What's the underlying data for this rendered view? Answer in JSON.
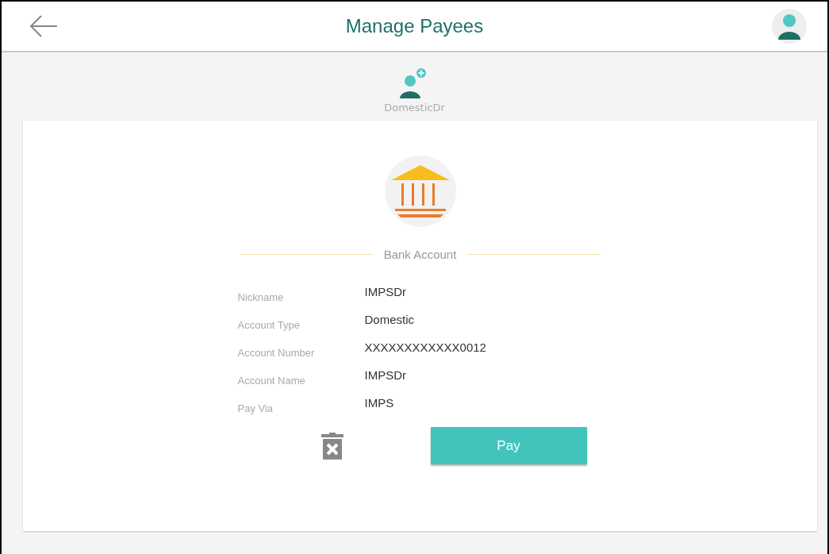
{
  "header": {
    "title": "Manage Payees"
  },
  "payee": {
    "name": "DomesticDr"
  },
  "account": {
    "section_title": "Bank Account",
    "fields": [
      {
        "label": "Nickname",
        "value": "IMPSDr"
      },
      {
        "label": "Account Type",
        "value": "Domestic"
      },
      {
        "label": "Account Number",
        "value": "XXXXXXXXXXXX0012"
      },
      {
        "label": "Account Name",
        "value": "IMPSDr"
      },
      {
        "label": "Pay Via",
        "value": "IMPS"
      }
    ]
  },
  "actions": {
    "primary": "Pay"
  }
}
